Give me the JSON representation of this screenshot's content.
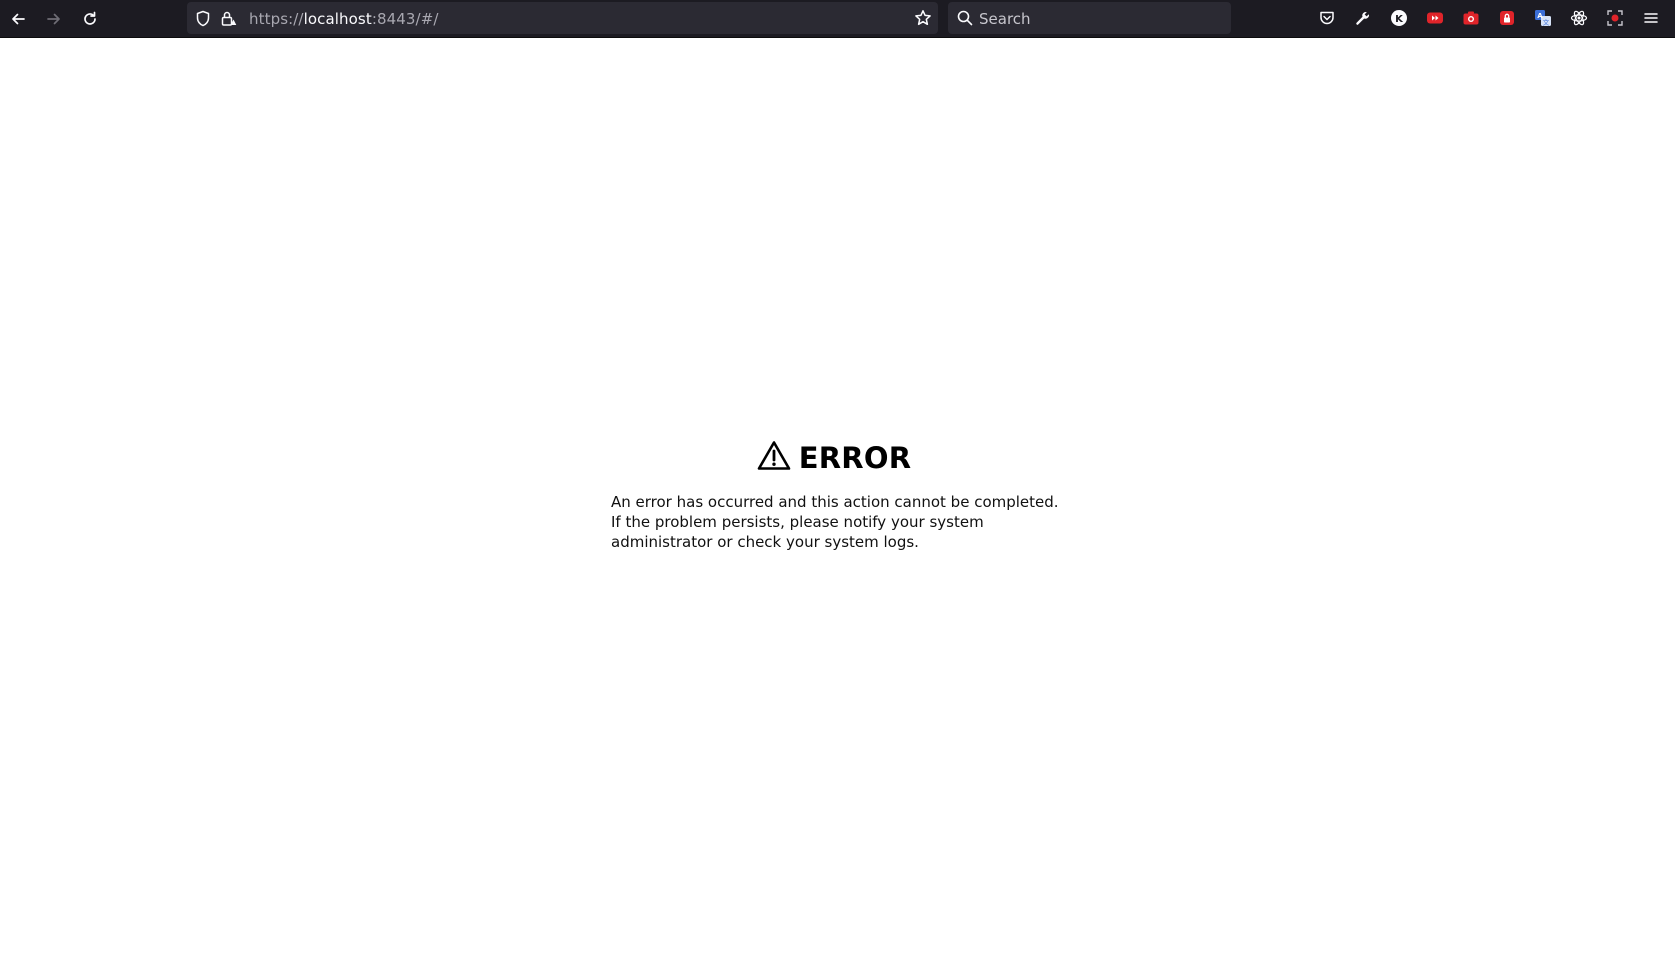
{
  "browser": {
    "url": {
      "scheme": "https://",
      "host": "localhost",
      "rest": ":8443/#/"
    },
    "search_placeholder": "Search",
    "extension_icons": [
      "pocket-icon",
      "wrench-icon",
      "k-extension-icon",
      "youtube-icon",
      "camera-icon",
      "red-lock-icon",
      "translate-icon",
      "react-devtools-icon",
      "screen-record-icon",
      "hamburger-menu-icon"
    ]
  },
  "error": {
    "title": "ERROR",
    "message": "An error has occurred and this action cannot be completed. If the problem persists, please notify your system administrator or check your system logs."
  }
}
